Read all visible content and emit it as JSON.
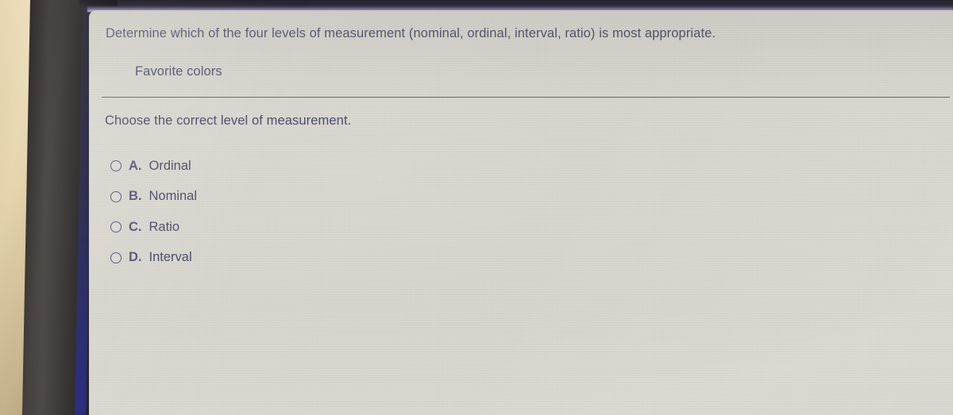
{
  "question": {
    "stem": "Determine which of the four levels of measurement (nominal, ordinal, interval, ratio) is most appropriate.",
    "subject": "Favorite colors",
    "prompt": "Choose the correct level of measurement."
  },
  "options": [
    {
      "letter": "A.",
      "label": "Ordinal",
      "selected": false
    },
    {
      "letter": "B.",
      "label": "Nominal",
      "selected": false
    },
    {
      "letter": "C.",
      "label": "Ratio",
      "selected": false
    },
    {
      "letter": "D.",
      "label": "Interval",
      "selected": false
    }
  ],
  "colors": {
    "screen_background": "#d6d4cb",
    "text": "#2b2950",
    "option_letter": "#3a3468",
    "divider": "#46444e",
    "bezel": "#2e2b2b",
    "panel_edge_blue": "#262c8c",
    "panel_top_purple": "#6f6790",
    "wall": "#e0cfa4"
  }
}
